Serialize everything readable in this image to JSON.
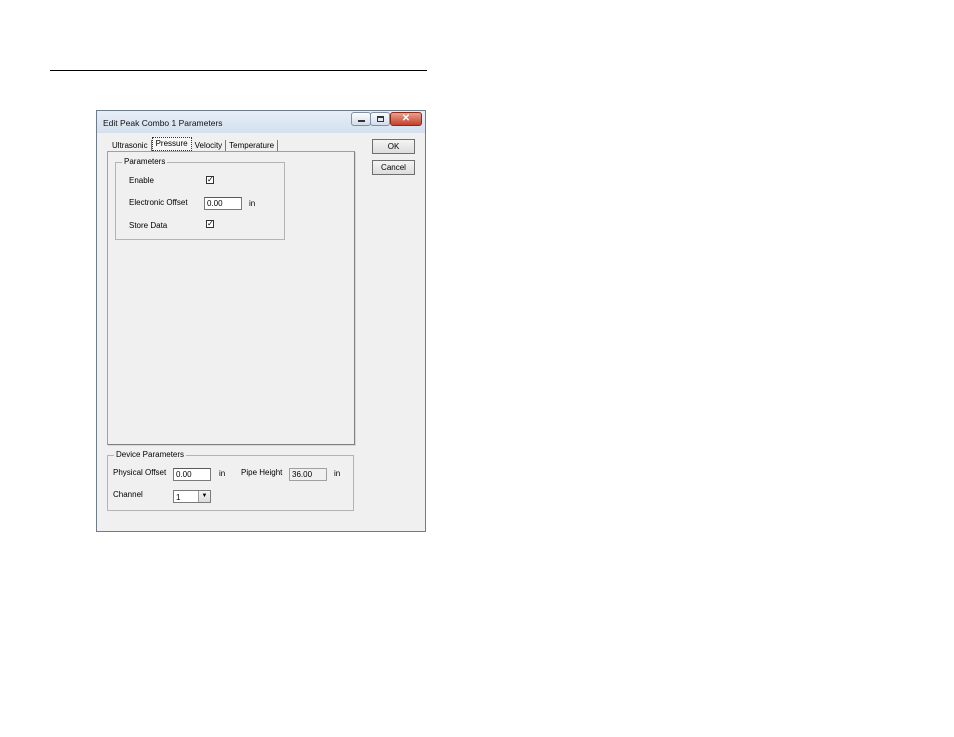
{
  "window": {
    "title": "Edit Peak Combo 1 Parameters",
    "min_glyph": "",
    "close_glyph": "✕"
  },
  "tabs": [
    {
      "label": "Ultrasonic"
    },
    {
      "label": "Pressure",
      "active": true
    },
    {
      "label": "Velocity"
    },
    {
      "label": "Temperature"
    }
  ],
  "parameters": {
    "group_label": "Parameters",
    "enable_label": "Enable",
    "enable_checked": true,
    "electronic_offset_label": "Electronic Offset",
    "electronic_offset_value": "0.00",
    "electronic_offset_unit": "in",
    "store_data_label": "Store Data",
    "store_data_checked": true
  },
  "device": {
    "group_label": "Device Parameters",
    "physical_offset_label": "Physical Offset",
    "physical_offset_value": "0.00",
    "physical_offset_unit": "in",
    "pipe_height_label": "Pipe Height",
    "pipe_height_value": "36.00",
    "pipe_height_unit": "in",
    "channel_label": "Channel",
    "channel_value": "1"
  },
  "buttons": {
    "ok": "OK",
    "cancel": "Cancel"
  },
  "check_glyph": "✓"
}
